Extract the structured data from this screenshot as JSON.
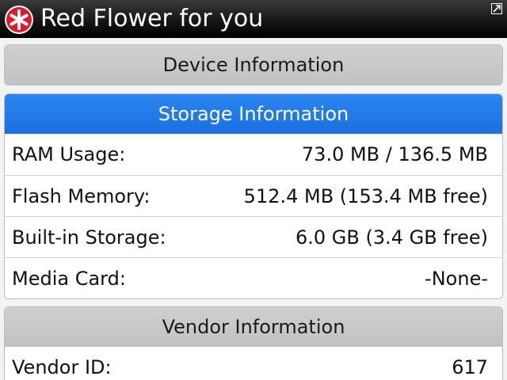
{
  "titlebar": {
    "title": "Red Flower for you",
    "app_icon": "red-flower-icon",
    "expand_icon": "expand-icon"
  },
  "sections": {
    "device": {
      "header": "Device Information"
    },
    "storage": {
      "header": "Storage Information",
      "rows": [
        {
          "label": "RAM Usage:",
          "value": "73.0 MB / 136.5 MB"
        },
        {
          "label": "Flash Memory:",
          "value": "512.4 MB (153.4 MB free)"
        },
        {
          "label": "Built-in Storage:",
          "value": "6.0 GB (3.4 GB free)"
        },
        {
          "label": "Media Card:",
          "value": "-None-"
        }
      ]
    },
    "vendor": {
      "header": "Vendor Information",
      "rows": [
        {
          "label": "Vendor ID:",
          "value": "617"
        }
      ]
    }
  },
  "colors": {
    "titlebar": "#000000",
    "selected_header": "#1b6fe0",
    "header": "#c8c8c8",
    "icon_red": "#e0192b"
  }
}
